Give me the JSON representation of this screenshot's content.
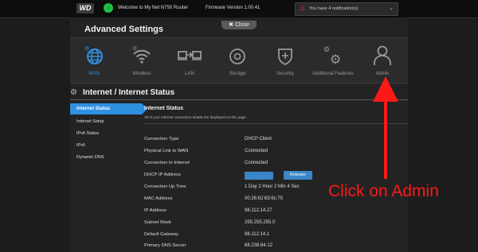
{
  "topbar": {
    "logo_text": "WD",
    "welcome": "Welcome to My Net N750 Router",
    "firmware": "Firmware Version 1.00.41",
    "notification": "You have 4 notification(s)"
  },
  "panel": {
    "close_label": "Close",
    "title": "Advanced Settings"
  },
  "nav": {
    "active_color": "#2f8fe0",
    "items": [
      {
        "label": "WAN",
        "icon": "globe-icon"
      },
      {
        "label": "Wireless",
        "icon": "wifi-icon"
      },
      {
        "label": "LAN",
        "icon": "lan-icon"
      },
      {
        "label": "Storage",
        "icon": "storage-icon"
      },
      {
        "label": "Security",
        "icon": "shield-icon"
      },
      {
        "label": "Additional Features",
        "icon": "gears-icon"
      },
      {
        "label": "Admin",
        "icon": "user-icon"
      }
    ]
  },
  "section": {
    "title": "Internet / Internet Status"
  },
  "sidebar": {
    "items": [
      "Internet Status",
      "Internet Setup",
      "IPv6 Status",
      "IPv6",
      "Dynamic DNS"
    ]
  },
  "content": {
    "title": "Internet Status",
    "description": "All of your Internet connection details are displayed on this page.",
    "rows": [
      {
        "label": "Connection Type",
        "value": "DHCP Client"
      },
      {
        "label": "Physical Link to WAN",
        "value": "Connected"
      },
      {
        "label": "Connection to Internet",
        "value": "Connected"
      },
      {
        "label": "DHCP IP Address",
        "value": ""
      },
      {
        "label": "Connection Up Time",
        "value": "1 Day 2 Hour 2 Min 4 Sec"
      },
      {
        "label": "MAC Address",
        "value": "00:26:62:63:6c:75"
      },
      {
        "label": "IP Address",
        "value": "98.112.14.27"
      },
      {
        "label": "Subnet Mask",
        "value": "255.255.255.0"
      },
      {
        "label": "Default Gateway",
        "value": "98.112.14.1"
      },
      {
        "label": "Primary DNS Server",
        "value": "68.238.64.12"
      }
    ],
    "release_label": "Release"
  },
  "annotation": {
    "text": "Click on Admin",
    "color": "#ff1818"
  }
}
